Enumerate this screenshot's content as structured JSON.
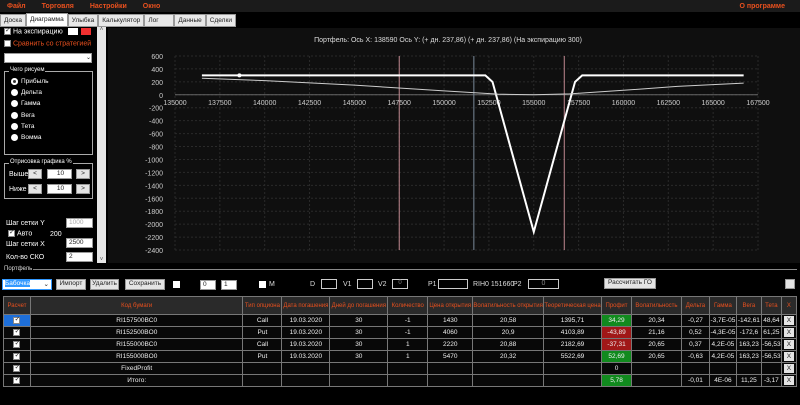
{
  "menu": [
    "Файл",
    "Торговля",
    "Настройки",
    "Окно"
  ],
  "menu_right": "О программе",
  "tabs": [
    "Доска",
    "Диаграмма",
    "Улыбка",
    "Калькулятор",
    "Лог",
    "Данные",
    "Сделки"
  ],
  "left": {
    "expiry_label": "На экспирацию",
    "compare_label": "Сравнить со стратегией",
    "what_group": "Чего рисуем",
    "radios": [
      "Прибыль",
      "Дельта",
      "Гамма",
      "Вега",
      "Тета",
      "Вомма"
    ],
    "draw_group": "Отрисовка графика %",
    "above_label": "Выше",
    "above_value": "10",
    "below_label": "Ниже",
    "below_value": "10",
    "lt": "<",
    "gt": ">",
    "grid_y_label": "Шаг сетки Y",
    "grid_y_value": "1000",
    "auto_label": "Авто",
    "auto_value": "200",
    "grid_x_label": "Шаг сетки X",
    "grid_x_value": "2500",
    "sko_label": "Кол-во СКО",
    "sko_value": "2"
  },
  "chart_data": {
    "type": "line",
    "title": "Портфель: Ось X: 138590 Ось Y:  (+ дн. 237,86)  (+ дн. 237,86)  (На экспирацию 300)",
    "xlim": [
      135000,
      167500
    ],
    "ylim": [
      -2400,
      600
    ],
    "xticks": [
      "135000",
      "137500",
      "140000",
      "142500",
      "145000",
      "147500",
      "150000",
      "152500",
      "155000",
      "157500",
      "160000",
      "162500",
      "165000",
      "167500"
    ],
    "yticks": [
      "600",
      "400",
      "200",
      "0",
      "-200",
      "-400",
      "-600",
      "-800",
      "-1000",
      "-1200",
      "-1400",
      "-1600",
      "-1800",
      "-2000",
      "-2200",
      "-2400"
    ],
    "series": [
      {
        "name": "expiry",
        "color": "#ffffff",
        "x": [
          136500,
          152300,
          152700,
          155000,
          157300,
          157700,
          166700
        ],
        "y": [
          300,
          300,
          200,
          -2120,
          200,
          300,
          300
        ]
      },
      {
        "name": "today",
        "color": "#cccccc",
        "x": [
          136500,
          140000,
          145000,
          150000,
          153000,
          155000,
          157000,
          160000,
          163000,
          166700
        ],
        "y": [
          255,
          220,
          150,
          60,
          10,
          0,
          15,
          70,
          130,
          180
        ]
      }
    ],
    "marker": {
      "x": 138590,
      "y": 300
    },
    "vlines": [
      {
        "x": 147500,
        "color": "#c08890"
      },
      {
        "x": 151660,
        "color": "#7a8a99"
      },
      {
        "x": 156700,
        "color": "#c08890"
      }
    ]
  },
  "portfolio": {
    "group": "Портфель",
    "strategy": "Бабочка",
    "import": "Импорт",
    "delete": "Удалить",
    "save": "Сохранить",
    "spin1": "0",
    "spin2": "1",
    "m_label": "M",
    "d_label": "D",
    "v1_label": "V1",
    "v2_label": "V2",
    "v2_value": "0",
    "p1_label": "P1",
    "ticker": "RIH0 151660",
    "p2_label": "P2",
    "p2_value": "0",
    "calc_go": "Рассчитать ГО",
    "headers": [
      "Расчет",
      "Код бумаги",
      "Тип опциона",
      "Дата погашения",
      "Дней до погашения",
      "Количество",
      "Цена открытия",
      "Волатильность открытия",
      "Теоретическая цена",
      "Профит",
      "Волатильность",
      "Дельта",
      "Гамма",
      "Вега",
      "Тета",
      "X"
    ],
    "rows": [
      [
        "RI157500BC0",
        "Call",
        "19.03.2020",
        "30",
        "-1",
        "1430",
        "20,58",
        "1395,71",
        "34,29",
        "20,34",
        "-0,27",
        "-3,7E-05",
        "-142,61",
        "48,64",
        "X"
      ],
      [
        "RI152500BO0",
        "Put",
        "19.03.2020",
        "30",
        "-1",
        "4060",
        "20,9",
        "4103,89",
        "-43,89",
        "21,16",
        "0,52",
        "-4,3E-05",
        "-172,6",
        "61,25",
        "X"
      ],
      [
        "RI155000BC0",
        "Call",
        "19.03.2020",
        "30",
        "1",
        "2220",
        "20,88",
        "2182,69",
        "-37,31",
        "20,65",
        "0,37",
        "4,2E-05",
        "163,23",
        "-56,53",
        "X"
      ],
      [
        "RI155000BO0",
        "Put",
        "19.03.2020",
        "30",
        "1",
        "5470",
        "20,32",
        "5522,69",
        "52,69",
        "20,65",
        "-0,63",
        "4,2E-05",
        "163,23",
        "-56,53",
        "X"
      ],
      [
        "FixedProfit",
        "",
        "",
        "",
        "",
        "",
        "",
        "",
        "0",
        "",
        "",
        "",
        "",
        "",
        "X"
      ],
      [
        "Итого:",
        "",
        "",
        "",
        "",
        "",
        "",
        "",
        "5,78",
        "",
        "-0,01",
        "4E-06",
        "11,25",
        "-3,17",
        "X"
      ]
    ],
    "profit_colors": [
      "g",
      "r",
      "r",
      "g",
      "",
      "g"
    ]
  }
}
